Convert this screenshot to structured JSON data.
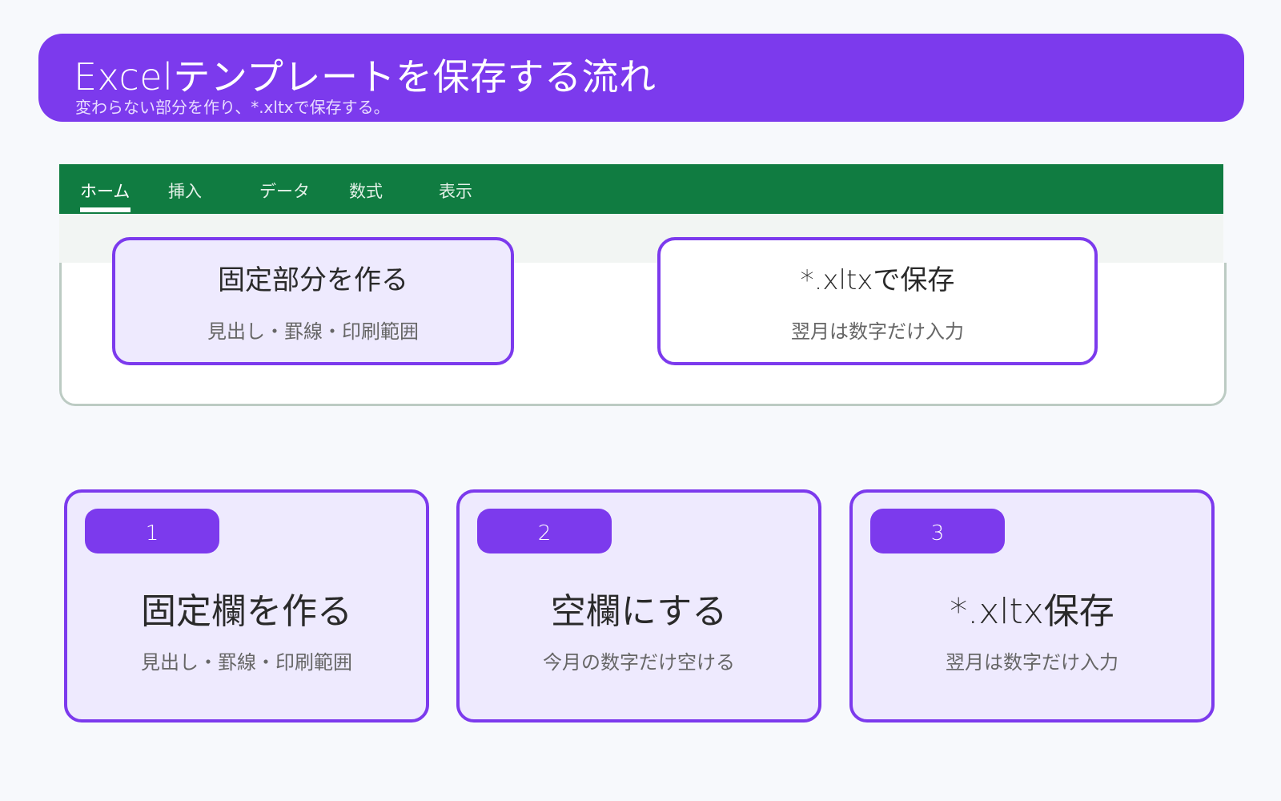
{
  "header": {
    "title": "Excelテンプレートを保存する流れ",
    "subtitle": "変わらない部分を作り、*.xltxで保存する。"
  },
  "ribbon": {
    "tabs": [
      {
        "label": "ホーム",
        "active": true
      },
      {
        "label": "挿入",
        "active": false
      },
      {
        "label": "データ",
        "active": false
      },
      {
        "label": "数式",
        "active": false
      },
      {
        "label": "表示",
        "active": false
      }
    ],
    "color": "#107c41"
  },
  "sheet": {
    "cards": [
      {
        "title": "固定部分を作る",
        "note": "見出し・罫線・印刷範囲"
      },
      {
        "title": "*.xltxで保存",
        "note": "翌月は数字だけ入力"
      }
    ]
  },
  "steps": [
    {
      "number": "1",
      "title": "固定欄を作る",
      "note": "見出し・罫線・印刷範囲"
    },
    {
      "number": "2",
      "title": "空欄にする",
      "note": "今月の数字だけ空ける"
    },
    {
      "number": "3",
      "title": "*.xltx保存",
      "note": "翌月は数字だけ入力"
    }
  ],
  "colors": {
    "accent": "#7c3aed",
    "card_fill": "#eeeafe",
    "excel_green": "#107c41"
  }
}
